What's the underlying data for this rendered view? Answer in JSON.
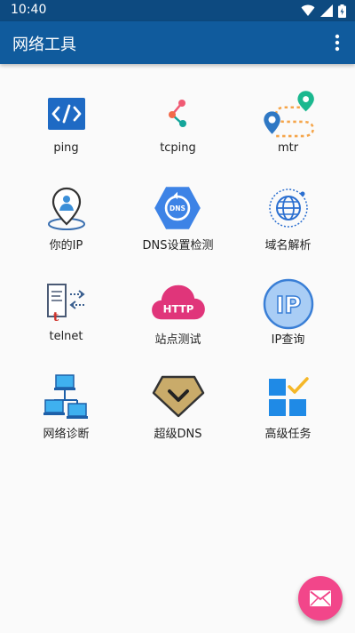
{
  "status_bar": {
    "time": "10:40",
    "icons": [
      "wifi-icon",
      "signal-icon",
      "battery-icon"
    ]
  },
  "app_bar": {
    "title": "网络工具",
    "menu_icon": "more-vert-icon"
  },
  "tools": [
    {
      "id": "ping",
      "label": "ping",
      "icon": "code-icon"
    },
    {
      "id": "tcping",
      "label": "tcping",
      "icon": "share-icon"
    },
    {
      "id": "mtr",
      "label": "mtr",
      "icon": "route-map-icon"
    },
    {
      "id": "my-ip",
      "label": "你的IP",
      "icon": "location-pin-icon"
    },
    {
      "id": "dns-check",
      "label": "DNS设置检测",
      "icon": "dns-refresh-icon"
    },
    {
      "id": "domain-resolve",
      "label": "域名解析",
      "icon": "globe-icon"
    },
    {
      "id": "telnet",
      "label": "telnet",
      "icon": "terminal-transfer-icon"
    },
    {
      "id": "site-test",
      "label": "站点测试",
      "icon": "http-cloud-icon"
    },
    {
      "id": "ip-query",
      "label": "IP查询",
      "icon": "ip-badge-icon"
    },
    {
      "id": "network-diagnose",
      "label": "网络诊断",
      "icon": "network-computers-icon"
    },
    {
      "id": "super-dns",
      "label": "超级DNS",
      "icon": "gem-chevron-icon"
    },
    {
      "id": "advanced-tasks",
      "label": "高级任务",
      "icon": "task-grid-check-icon"
    }
  ],
  "fab": {
    "icon": "mail-icon"
  },
  "colors": {
    "status_bar": "#0d4a80",
    "app_bar": "#105b9d",
    "fab": "#f2468a",
    "background": "#fafafa"
  }
}
